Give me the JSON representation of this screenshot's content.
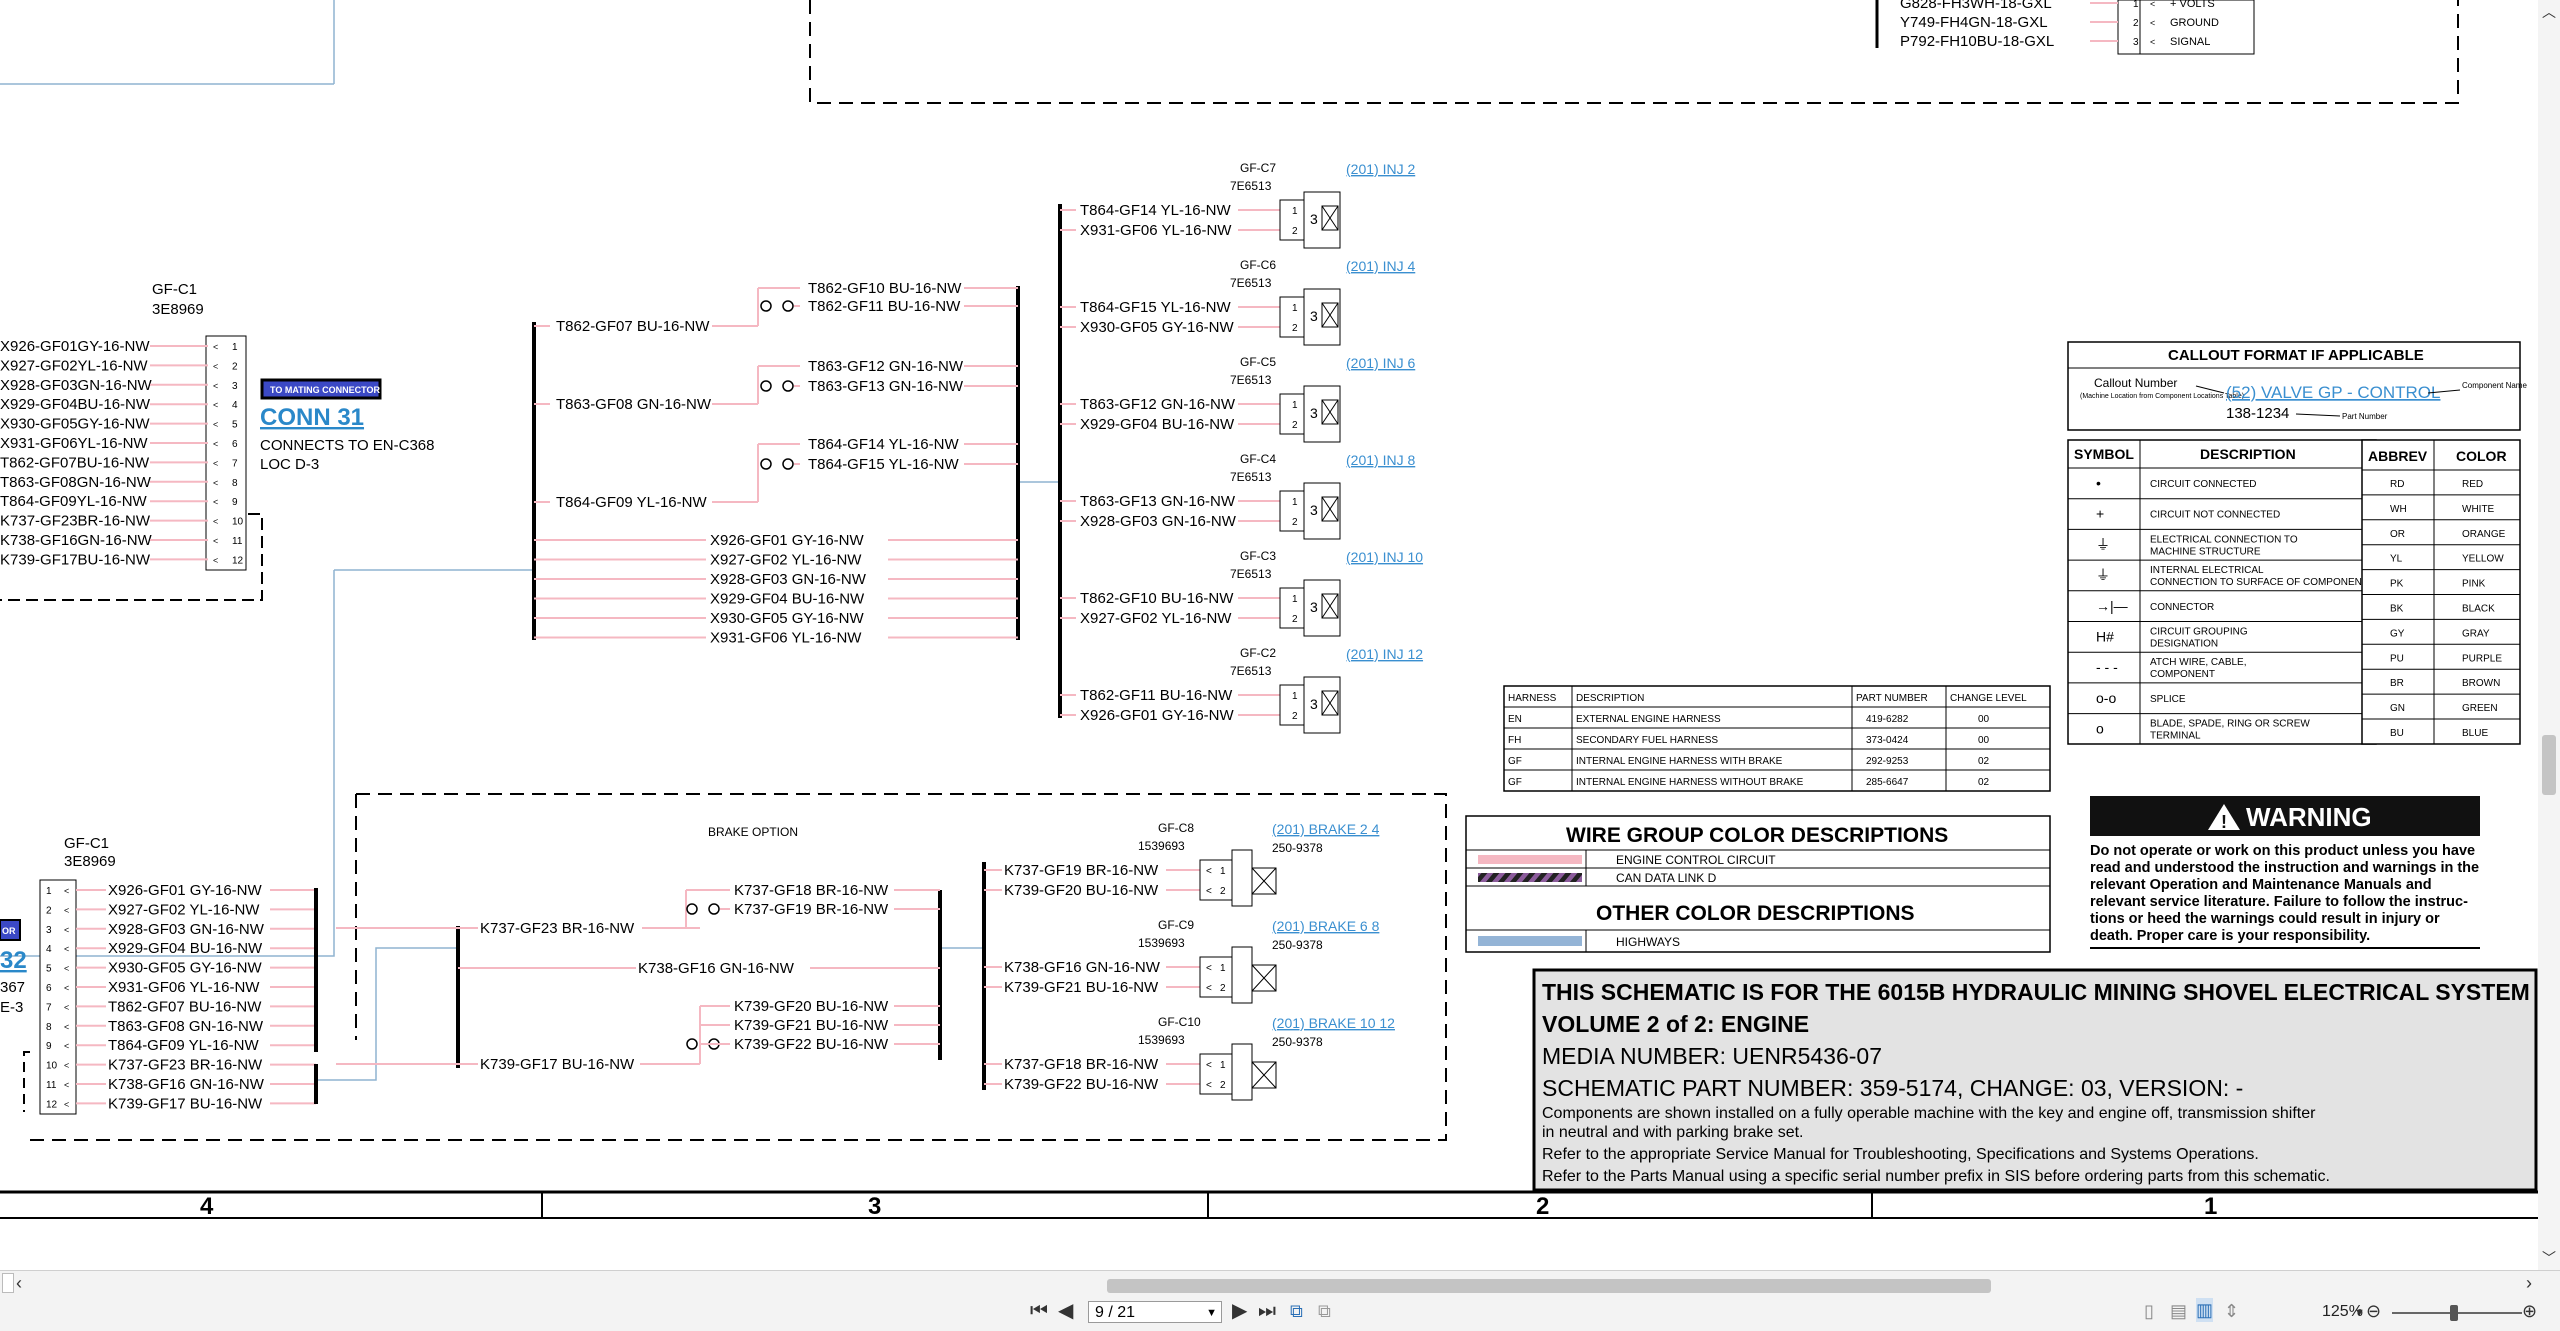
{
  "viewer": {
    "page_current": "9 / 21",
    "zoom_level": "125%"
  },
  "top_stub": {
    "wires": [
      "G828-FH3WH-18-GXL",
      "Y749-FH4GN-18-GXL",
      "P792-FH10BU-18-GXL"
    ],
    "pins": [
      "1",
      "2",
      "3"
    ],
    "pin_labels": [
      "+ VOLTS",
      "GROUND",
      "SIGNAL"
    ]
  },
  "gfc1_top": {
    "name": "GF-C1",
    "part": "3E8969",
    "wires": [
      "X926-GF01GY-16-NW",
      "X927-GF02YL-16-NW",
      "X928-GF03GN-16-NW",
      "X929-GF04BU-16-NW",
      "X930-GF05GY-16-NW",
      "X931-GF06YL-16-NW",
      "T862-GF07BU-16-NW",
      "T863-GF08GN-16-NW",
      "T864-GF09YL-16-NW",
      "K737-GF23BR-16-NW",
      "K738-GF16GN-16-NW",
      "K739-GF17BU-16-NW"
    ],
    "pins": [
      "1",
      "2",
      "3",
      "4",
      "5",
      "6",
      "7",
      "8",
      "9",
      "10",
      "11",
      "12"
    ]
  },
  "conn31": {
    "badge": "TO MATING CONNECTOR",
    "title": "CONN 31",
    "line1": "CONNECTS TO EN-C368",
    "line2": "LOC D-3"
  },
  "mid_bundle": {
    "left_labels": [
      "T862-GF07 BU-16-NW",
      "T863-GF08 GN-16-NW",
      "T864-GF09 YL-16-NW"
    ],
    "splice_labels": [
      "T862-GF10 BU-16-NW",
      "T862-GF11 BU-16-NW",
      "T863-GF12 GN-16-NW",
      "T863-GF13 GN-16-NW",
      "T864-GF14 YL-16-NW",
      "T864-GF15 YL-16-NW"
    ],
    "lower_labels": [
      "X926-GF01 GY-16-NW",
      "X927-GF02 YL-16-NW",
      "X928-GF03 GN-16-NW",
      "X929-GF04 BU-16-NW",
      "X930-GF05 GY-16-NW",
      "X931-GF06 YL-16-NW"
    ]
  },
  "injectors": [
    {
      "name": "GF-C7",
      "part": "7E6513",
      "link": "(201) INJ 2",
      "w1": "T864-GF14 YL-16-NW",
      "w2": "X931-GF06 YL-16-NW"
    },
    {
      "name": "GF-C6",
      "part": "7E6513",
      "link": "(201) INJ 4",
      "w1": "T864-GF15 YL-16-NW",
      "w2": "X930-GF05 GY-16-NW"
    },
    {
      "name": "GF-C5",
      "part": "7E6513",
      "link": "(201) INJ 6",
      "w1": "T863-GF12 GN-16-NW",
      "w2": "X929-GF04 BU-16-NW"
    },
    {
      "name": "GF-C4",
      "part": "7E6513",
      "link": "(201) INJ 8",
      "w1": "T863-GF13 GN-16-NW",
      "w2": "X928-GF03 GN-16-NW"
    },
    {
      "name": "GF-C3",
      "part": "7E6513",
      "link": "(201) INJ 10",
      "w1": "T862-GF10 BU-16-NW",
      "w2": "X927-GF02 YL-16-NW"
    },
    {
      "name": "GF-C2",
      "part": "7E6513",
      "link": "(201) INJ 12",
      "w1": "T862-GF11 BU-16-NW",
      "w2": "X926-GF01 GY-16-NW"
    }
  ],
  "pin12": [
    "1",
    "2"
  ],
  "pin_coil": "3",
  "brake": {
    "title": "BRAKE OPTION",
    "gfc1_name": "GF-C1",
    "gfc1_part": "3E8969",
    "gfc1_wires": [
      "X926-GF01 GY-16-NW",
      "X927-GF02 YL-16-NW",
      "X928-GF03 GN-16-NW",
      "X929-GF04 BU-16-NW",
      "X930-GF05 GY-16-NW",
      "X931-GF06 YL-16-NW",
      "T862-GF07 BU-16-NW",
      "T863-GF08 GN-16-NW",
      "T864-GF09 YL-16-NW",
      "K737-GF23 BR-16-NW",
      "K738-GF16 GN-16-NW",
      "K739-GF17 BU-16-NW"
    ],
    "left_conn_frag": [
      "OR",
      "32",
      "367",
      "E-3"
    ],
    "trunk_labels": [
      "K737-GF23 BR-16-NW",
      "K738-GF16 GN-16-NW",
      "K739-GF17 BU-16-NW"
    ],
    "splice_labels": [
      "K737-GF18 BR-16-NW",
      "K737-GF19 BR-16-NW",
      "K739-GF20 BU-16-NW",
      "K739-GF21 BU-16-NW",
      "K739-GF22 BU-16-NW"
    ],
    "valves": [
      {
        "name": "GF-C8",
        "part": "1539693",
        "link": "(201) BRAKE 2 4",
        "sub": "250-9378",
        "w1": "K737-GF19 BR-16-NW",
        "w2": "K739-GF20 BU-16-NW"
      },
      {
        "name": "GF-C9",
        "part": "1539693",
        "link": "(201) BRAKE 6 8",
        "sub": "250-9378",
        "w1": "K738-GF16 GN-16-NW",
        "w2": "K739-GF21 BU-16-NW"
      },
      {
        "name": "GF-C10",
        "part": "1539693",
        "link": "(201) BRAKE 10 12",
        "sub": "250-9378",
        "w1": "K737-GF18 BR-16-NW",
        "w2": "K739-GF22 BU-16-NW"
      }
    ]
  },
  "callout": {
    "title": "CALLOUT FORMAT IF APPLICABLE",
    "callout_number": "Callout Number",
    "callout_note": "(Machine Location from Component Locations Table)",
    "valve_link": "(52) VALVE GP - CONTROL",
    "component_name": "Component Name",
    "part_num": "138-1234",
    "part_label": "Part Number"
  },
  "symbols": {
    "headers": [
      "SYMBOL",
      "DESCRIPTION"
    ],
    "rows": [
      {
        "sym": "•",
        "desc": "CIRCUIT CONNECTED"
      },
      {
        "sym": "+",
        "desc": "CIRCUIT NOT CONNECTED"
      },
      {
        "sym": "⏚",
        "desc": "ELECTRICAL CONNECTION TO MACHINE STRUCTURE"
      },
      {
        "sym": "⏚",
        "desc": "INTERNAL ELECTRICAL CONNECTION TO SURFACE OF COMPONENT"
      },
      {
        "sym": "→|—",
        "desc": "CONNECTOR"
      },
      {
        "sym": "H#",
        "desc": "CIRCUIT GROUPING DESIGNATION"
      },
      {
        "sym": "- - -",
        "desc": "ATCH WIRE, CABLE, COMPONENT"
      },
      {
        "sym": "o-o",
        "desc": "SPLICE"
      },
      {
        "sym": "o",
        "desc": "BLADE, SPADE, RING OR SCREW TERMINAL"
      }
    ]
  },
  "colors": {
    "headers": [
      "ABBREV",
      "COLOR"
    ],
    "rows": [
      [
        "RD",
        "RED"
      ],
      [
        "WH",
        "WHITE"
      ],
      [
        "OR",
        "ORANGE"
      ],
      [
        "YL",
        "YELLOW"
      ],
      [
        "PK",
        "PINK"
      ],
      [
        "BK",
        "BLACK"
      ],
      [
        "GY",
        "GRAY"
      ],
      [
        "PU",
        "PURPLE"
      ],
      [
        "BR",
        "BROWN"
      ],
      [
        "GN",
        "GREEN"
      ],
      [
        "BU",
        "BLUE"
      ]
    ]
  },
  "harness": {
    "headers": [
      "HARNESS",
      "DESCRIPTION",
      "PART NUMBER",
      "CHANGE LEVEL"
    ],
    "rows": [
      [
        "EN",
        "EXTERNAL ENGINE HARNESS",
        "419-6282",
        "00"
      ],
      [
        "FH",
        "SECONDARY FUEL HARNESS",
        "373-0424",
        "00"
      ],
      [
        "GF",
        "INTERNAL ENGINE HARNESS WITH BRAKE",
        "292-9253",
        "02"
      ],
      [
        "GF",
        "INTERNAL ENGINE HARNESS WITHOUT BRAKE",
        "285-6647",
        "02"
      ]
    ]
  },
  "wire_group": {
    "title": "WIRE GROUP COLOR DESCRIPTIONS",
    "item1": "ENGINE CONTROL CIRCUIT",
    "item2": "CAN DATA LINK D",
    "title2": "OTHER COLOR DESCRIPTIONS",
    "item3": "HIGHWAYS"
  },
  "warning": {
    "title": "WARNING",
    "l1": "Do not operate or work on this product unless you have",
    "l2": "read and understood the instruction and warnings in the",
    "l3": "relevant Operation and Maintenance Manuals and",
    "l4": "relevant service literature. Failure to follow the instruc-",
    "l5": "tions or heed the warnings could result in injury or",
    "l6": "death. Proper care is your responsibility."
  },
  "titleblock": {
    "l1": "THIS SCHEMATIC IS FOR THE 6015B HYDRAULIC MINING SHOVEL ELECTRICAL SYSTEM",
    "l2": "VOLUME 2 of 2: ENGINE",
    "l3": "MEDIA NUMBER: UENR5436-07",
    "l4": "SCHEMATIC PART NUMBER: 359-5174, CHANGE: 03, VERSION: -",
    "l5": "Components are shown installed on a fully operable machine with the key and engine off, transmission shifter",
    "l6": "in neutral and with parking brake set.",
    "l7": "Refer to the appropriate Service Manual for Troubleshooting, Specifications and Systems Operations.",
    "l8": "Refer to the Parts Manual using a specific serial number prefix in SIS before ordering parts from this schematic."
  },
  "zones": [
    "4",
    "3",
    "2",
    "1"
  ]
}
